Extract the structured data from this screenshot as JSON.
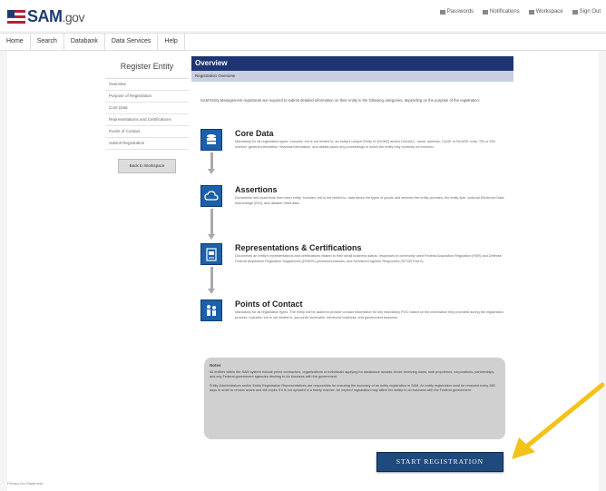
{
  "header": {
    "logo_text": "SAM",
    "logo_suffix": ".gov",
    "links": [
      {
        "label": "Passwords",
        "icon": "key-icon"
      },
      {
        "label": "Notifications",
        "icon": "bell-icon"
      },
      {
        "label": "Workspace",
        "icon": "grid-icon"
      },
      {
        "label": "Sign Out",
        "icon": "signout-icon"
      }
    ]
  },
  "nav": {
    "items": [
      "Home",
      "Search",
      "Databank",
      "Data Services",
      "Help"
    ]
  },
  "sidebar": {
    "title": "Register Entity",
    "items": [
      "Overview",
      "Purpose of Registration",
      "Core Data",
      "Representations and Certifications",
      "Points of Contact",
      "Submit Registration"
    ],
    "back_button": "Back to Workspace"
  },
  "main": {
    "overview_title": "Overview",
    "overview_subtitle": "Registration Overview",
    "intro": "SAM Entity Management registrants are required to submit detailed information on their entity in the following categories, depending on the purpose of the registration:",
    "sections": [
      {
        "title": "Core Data",
        "icon": "database-icon",
        "description": "Mandatory for all registration types. Includes, but is not limited to, an entity's Unique Entity ID (DUNS) and/or DoDAAC, name, address, CAGE or NCAGE code, TIN or EIN number, general information, financial information, and details about any proceedings in which the entity may currently be involved."
      },
      {
        "title": "Assertions",
        "icon": "cloud-icon",
        "description": "Documents self-assertions from each entity. Includes, but is not limited to, data about the types of goods and services the entity provides, the entity size, optional Electronic Data Interchange (EDI), and disaster relief data."
      },
      {
        "title": "Representations & Certifications",
        "icon": "certificate-icon",
        "description": "Documents an entity's representations and certifications related to their small business status, responses to commonly used Federal Acquisition Regulation (FAR) and Defense Federal Acquisition Regulation Supplement (DFARS) provisions/clauses, and Architect-Engineer Responses (SF330 Part II)."
      },
      {
        "title": "Points of Contact",
        "icon": "people-icon",
        "description": "Mandatory for all registration types. The entity will be asked to provide contact information for key mandatory POC based on the information they provided during the registration process. Includes, but is not limited to, accounts receivable, electronic business, and government business."
      }
    ],
    "notes_title": "Notes",
    "notes_lines": [
      "All entities within the SAM system include prime contractors, organizations or individuals applying for assistance awards, those receiving loans, sole proprietors, corporations, partnerships, and any Federal government agencies desiring to do business with the government.",
      "Entity Administrators and/or Entity Registration Representatives are responsible for ensuring the accuracy of an entity registration in SAM. An entity registration must be renewed every 365 days in order to remain active and will expire if it is not updated in a timely manner. An expired registration may affect the ability to do business with the Federal government."
    ],
    "start_button": "START REGISTRATION"
  },
  "footer": {
    "text": "Privacy Act Statement"
  },
  "colors": {
    "brand_navy": "#1f3573",
    "button_blue": "#1f4a7d",
    "icon_blue": "#1d5fa8",
    "arrow": "#f3c21b"
  }
}
